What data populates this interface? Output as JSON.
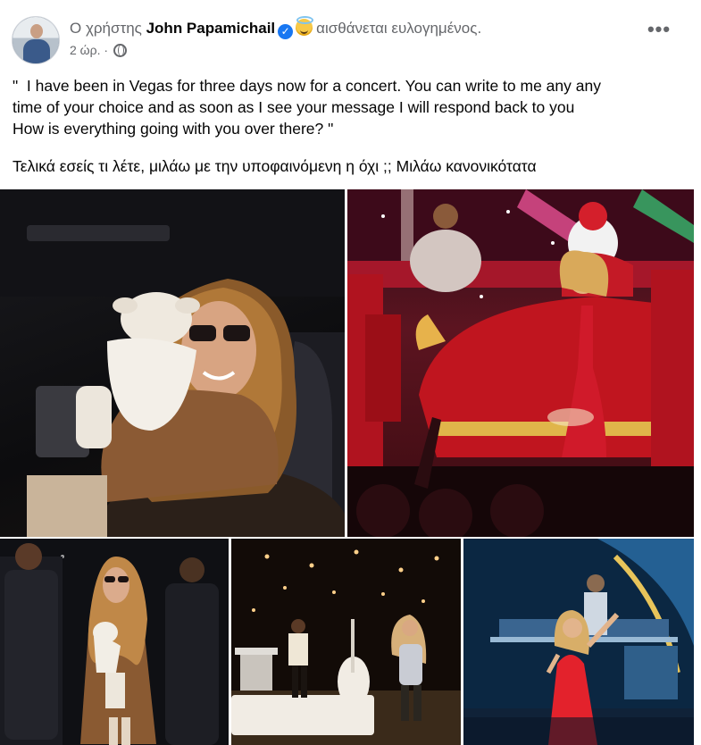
{
  "post": {
    "header_prefix": "Ο χρήστης",
    "author_name": "John Papamichail",
    "verified_icon": "verified-badge-icon",
    "feeling_icon": "halo-face-emoji",
    "feeling_text": "αισθάνεται ευλογημένος.",
    "time_text": "2 ώρ. ·",
    "audience_icon": "globe-icon",
    "more_label": "•••",
    "body_line_1": "\"  I have been in Vegas for three days now for a concert. You can write to me any any\ntime of your choice and as soon as I see your message I will respond back to you\nHow is everything going with you over there? \"",
    "body_line_2": "Τελικά εσείς τι λέτε,  μιλάω με την υποφαινόμενη  η όχι  ;; Μιλάω κανονικότατα"
  },
  "photos": [
    {
      "name": "photo-woman-in-car-with-plush-lamb"
    },
    {
      "name": "photo-stage-santa-sleigh-performance"
    },
    {
      "name": "photo-woman-walking-in-brown-coat"
    },
    {
      "name": "photo-stage-band-and-singer"
    },
    {
      "name": "photo-singer-red-dress-blue-stage"
    }
  ],
  "colors": {
    "text_primary": "#050505",
    "text_secondary": "#65676b",
    "verified_blue": "#1877f2"
  }
}
